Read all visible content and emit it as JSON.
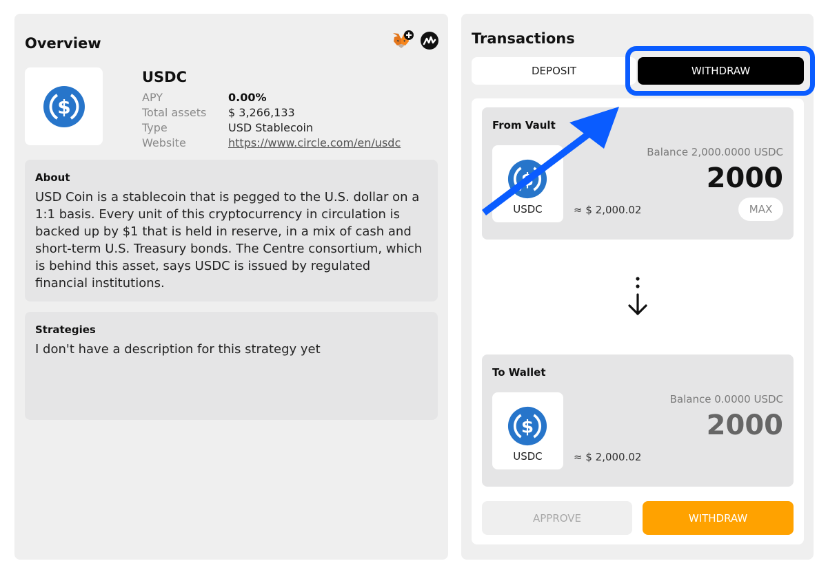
{
  "colors": {
    "accent_orange": "#ffa200",
    "highlight_blue": "#0a5cff",
    "usdc_blue": "#2775ca",
    "panel_gray": "#efefef"
  },
  "overview": {
    "title": "Overview",
    "icons": [
      "metamask-add-icon",
      "exchange-logo-icon"
    ],
    "asset": {
      "icon": "usdc-icon",
      "name": "USDC",
      "rows": [
        {
          "label": "APY",
          "value": "0.00%"
        },
        {
          "label": "Total assets",
          "value": "$ 3,266,133"
        },
        {
          "label": "Type",
          "value": "USD Stablecoin"
        },
        {
          "label": "Website",
          "value": "https://www.circle.com/en/usdc"
        }
      ]
    },
    "about": {
      "heading": "About",
      "body": "USD Coin is a stablecoin that is pegged to the U.S. dollar on a 1:1 basis. Every unit of this cryptocurrency in circulation is backed up by $1 that is held in reserve, in a mix of cash and short-term U.S. Treasury bonds. The Centre consortium, which is behind this asset, says USDC is issued by regulated financial institutions."
    },
    "strategies": {
      "heading": "Strategies",
      "body": "I don't have a description for this strategy yet"
    }
  },
  "transactions": {
    "title": "Transactions",
    "tabs": [
      {
        "label": "DEPOSIT",
        "active": false
      },
      {
        "label": "WITHDRAW",
        "active": true
      }
    ],
    "from": {
      "heading": "From Vault",
      "token": "USDC",
      "balance": "Balance 2,000.0000 USDC",
      "amount": "2000",
      "usd": "≈ $ 2,000.02",
      "max_label": "MAX"
    },
    "to": {
      "heading": "To Wallet",
      "token": "USDC",
      "balance": "Balance 0.0000 USDC",
      "amount": "2000",
      "usd": "≈ $ 2,000.02"
    },
    "direction_icon": "arrow-down-icon",
    "actions": {
      "approve": "APPROVE",
      "withdraw": "WITHDRAW"
    }
  }
}
